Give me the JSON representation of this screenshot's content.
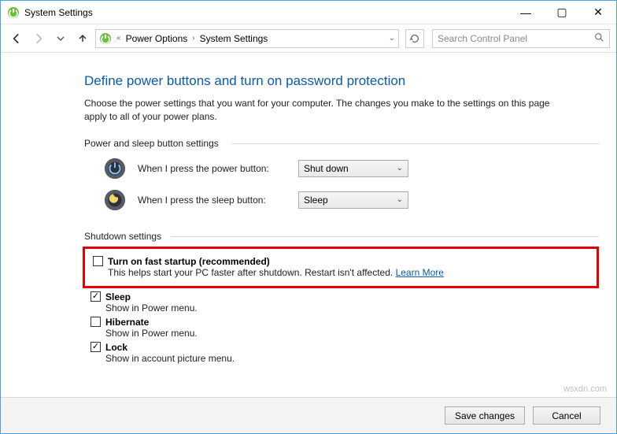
{
  "window": {
    "title": "System Settings"
  },
  "nav": {
    "path": [
      "Power Options",
      "System Settings"
    ],
    "searchPlaceholder": "Search Control Panel"
  },
  "page": {
    "title": "Define power buttons and turn on password protection",
    "description": "Choose the power settings that you want for your computer. The changes you make to the settings on this page apply to all of your power plans."
  },
  "groups": {
    "buttonsLabel": "Power and sleep button settings",
    "powerRow": {
      "label": "When I press the power button:",
      "value": "Shut down"
    },
    "sleepRow": {
      "label": "When I press the sleep button:",
      "value": "Sleep"
    },
    "shutdownLabel": "Shutdown settings"
  },
  "shutdown": {
    "fastStartup": {
      "title": "Turn on fast startup (recommended)",
      "sub": "This helps start your PC faster after shutdown. Restart isn't affected. ",
      "link": "Learn More"
    },
    "sleep": {
      "title": "Sleep",
      "sub": "Show in Power menu."
    },
    "hibernate": {
      "title": "Hibernate",
      "sub": "Show in Power menu."
    },
    "lock": {
      "title": "Lock",
      "sub": "Show in account picture menu."
    }
  },
  "footer": {
    "save": "Save changes",
    "cancel": "Cancel"
  },
  "watermark": "wsxdn.com"
}
